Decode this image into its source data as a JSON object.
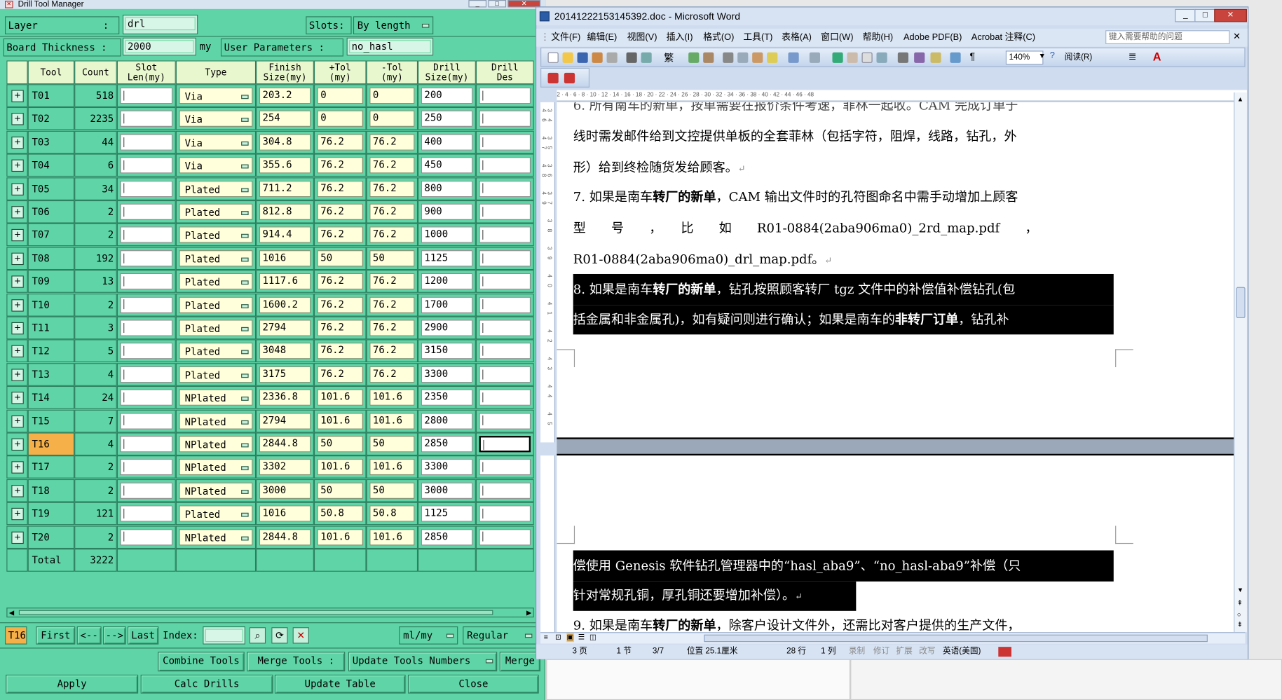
{
  "drill_tool_manager": {
    "title": "Drill Tool Manager",
    "layer_label": "Layer",
    "layer_colon": ":",
    "layer_value": "drl",
    "slots_label": "Slots:",
    "slots_value": "By length",
    "board_thickness_label": "Board Thickness :",
    "board_thickness_value": "2000",
    "board_thickness_unit": "my",
    "user_params_label": "User Parameters :",
    "user_params_value": "no_hasl",
    "headers": {
      "tool": "Tool",
      "count": "Count",
      "slot_len": "Slot\nLen(my)",
      "type": "Type",
      "finish_size": "Finish\nSize(my)",
      "plus_tol": "+Tol\n(my)",
      "minus_tol": "-Tol\n(my)",
      "drill_size": "Drill\nSize(my)",
      "drill_des": "Drill\nDes"
    },
    "rows": [
      {
        "tool": "T01",
        "count": "518",
        "type": "Via",
        "finish": "203.2",
        "ptol": "0",
        "mtol": "0",
        "drill": "200"
      },
      {
        "tool": "T02",
        "count": "2235",
        "type": "Via",
        "finish": "254",
        "ptol": "0",
        "mtol": "0",
        "drill": "250"
      },
      {
        "tool": "T03",
        "count": "44",
        "type": "Via",
        "finish": "304.8",
        "ptol": "76.2",
        "mtol": "76.2",
        "drill": "400"
      },
      {
        "tool": "T04",
        "count": "6",
        "type": "Via",
        "finish": "355.6",
        "ptol": "76.2",
        "mtol": "76.2",
        "drill": "450"
      },
      {
        "tool": "T05",
        "count": "34",
        "type": "Plated",
        "finish": "711.2",
        "ptol": "76.2",
        "mtol": "76.2",
        "drill": "800"
      },
      {
        "tool": "T06",
        "count": "2",
        "type": "Plated",
        "finish": "812.8",
        "ptol": "76.2",
        "mtol": "76.2",
        "drill": "900"
      },
      {
        "tool": "T07",
        "count": "2",
        "type": "Plated",
        "finish": "914.4",
        "ptol": "76.2",
        "mtol": "76.2",
        "drill": "1000"
      },
      {
        "tool": "T08",
        "count": "192",
        "type": "Plated",
        "finish": "1016",
        "ptol": "50",
        "mtol": "50",
        "drill": "1125"
      },
      {
        "tool": "T09",
        "count": "13",
        "type": "Plated",
        "finish": "1117.6",
        "ptol": "76.2",
        "mtol": "76.2",
        "drill": "1200"
      },
      {
        "tool": "T10",
        "count": "2",
        "type": "Plated",
        "finish": "1600.2",
        "ptol": "76.2",
        "mtol": "76.2",
        "drill": "1700"
      },
      {
        "tool": "T11",
        "count": "3",
        "type": "Plated",
        "finish": "2794",
        "ptol": "76.2",
        "mtol": "76.2",
        "drill": "2900"
      },
      {
        "tool": "T12",
        "count": "5",
        "type": "Plated",
        "finish": "3048",
        "ptol": "76.2",
        "mtol": "76.2",
        "drill": "3150"
      },
      {
        "tool": "T13",
        "count": "4",
        "type": "Plated",
        "finish": "3175",
        "ptol": "76.2",
        "mtol": "76.2",
        "drill": "3300"
      },
      {
        "tool": "T14",
        "count": "24",
        "type": "NPlated",
        "finish": "2336.8",
        "ptol": "101.6",
        "mtol": "101.6",
        "drill": "2350"
      },
      {
        "tool": "T15",
        "count": "7",
        "type": "NPlated",
        "finish": "2794",
        "ptol": "101.6",
        "mtol": "101.6",
        "drill": "2800"
      },
      {
        "tool": "T16",
        "count": "4",
        "type": "NPlated",
        "finish": "2844.8",
        "ptol": "50",
        "mtol": "50",
        "drill": "2850"
      },
      {
        "tool": "T17",
        "count": "2",
        "type": "NPlated",
        "finish": "3302",
        "ptol": "101.6",
        "mtol": "101.6",
        "drill": "3300"
      },
      {
        "tool": "T18",
        "count": "2",
        "type": "NPlated",
        "finish": "3000",
        "ptol": "50",
        "mtol": "50",
        "drill": "3000"
      },
      {
        "tool": "T19",
        "count": "121",
        "type": "Plated",
        "finish": "1016",
        "ptol": "50.8",
        "mtol": "50.8",
        "drill": "1125"
      },
      {
        "tool": "T20",
        "count": "2",
        "type": "NPlated",
        "finish": "2844.8",
        "ptol": "101.6",
        "mtol": "101.6",
        "drill": "2850"
      }
    ],
    "selected_tool": "T16",
    "total_label": "Total",
    "total_count": "3222",
    "nav": {
      "current": "T16",
      "first": "First",
      "prev": "<--",
      "next": "-->",
      "last": "Last",
      "index_label": "Index:",
      "units": "ml/my",
      "mode": "Regular"
    },
    "buttons": {
      "combine": "Combine Tools",
      "merge": "Merge Tools :",
      "update_numbers": "Update Tools Numbers",
      "merge2": "Merge",
      "apply": "Apply",
      "calc": "Calc Drills",
      "update_table": "Update Table",
      "close": "Close"
    },
    "colors": {
      "background": "#5fd5a7",
      "cell": "#ffffdc",
      "selected": "#f6b04a"
    }
  },
  "word": {
    "title": "20141222153145392.doc - Microsoft Word",
    "menus": [
      "文件(F)",
      "编辑(E)",
      "视图(V)",
      "插入(I)",
      "格式(O)",
      "工具(T)",
      "表格(A)",
      "窗口(W)",
      "帮助(H)",
      "Adobe PDF(B)",
      "Acrobat 注释(C)"
    ],
    "help_placeholder": "键入需要帮助的问题",
    "zoom": "140%",
    "read_label": "阅读(R)",
    "ruler_text": "2 · 4 · 6 · 8 · 10 · 12 · 14 · 16 · 18 · 20 · 22 · 24 · 26 · 28 · 30 · 32 · 34 · 36 · 38 · 40 · 42 · 44 · 46 · 48",
    "vruler_text": "34 35 36 37 38 39 40 41 42 43 44 45 46 47 48 49",
    "doc": {
      "line0": "6. 所有南车的新单，按单需要在报价条件考速，菲林一起收。CAM 完成订单于",
      "line1": "线时需发邮件给到文控提供单板的全套菲林（包括字符，阻焊，线路，钻孔，外",
      "line2": "形）给到终检随货发给顾客。",
      "line3a": "7.  如果是南车",
      "line3b": "转厂的新单",
      "line3c": "，CAM 输出文件时的孔符图命名中需手动增加上顾客",
      "line4": "型　　号　　，　　比　　如　　R01-0884(2aba906ma0)_2rd_map.pdf　　，",
      "line5": "R01-0884(2aba906ma0)_drl_map.pdf。",
      "line6a": "8.  如果是南车",
      "line6b": "转厂的新单",
      "line6c": "，钻孔按照顾客转厂 tgz 文件中的补偿值补偿钻孔(包",
      "line7a": "括金属和非金属孔)，如有疑问则进行确认；如果是南车的",
      "line7b": "非转厂订单",
      "line7c": "，钻孔补",
      "line8": "偿使用 Genesis 软件钻孔管理器中的“hasl_aba9”、“no_hasl-aba9”补偿（只",
      "line9": "针对常规孔铜，厚孔铜还要增加补偿）。",
      "line10a": "9.  如果是南车",
      "line10b": "转厂的新单",
      "line10c": "，除客户设计文件外，还需比对客户提供的生产文件，",
      "pmark": "↵"
    },
    "status": {
      "page": "3 页",
      "section": "1 节",
      "pages": "3/7",
      "position": "位置 25.1厘米",
      "line": "28 行",
      "col": "1 列",
      "rec": "录制",
      "trk": "修订",
      "ext": "扩展",
      "ovr": "改写",
      "lang": "英语(美国)"
    }
  }
}
